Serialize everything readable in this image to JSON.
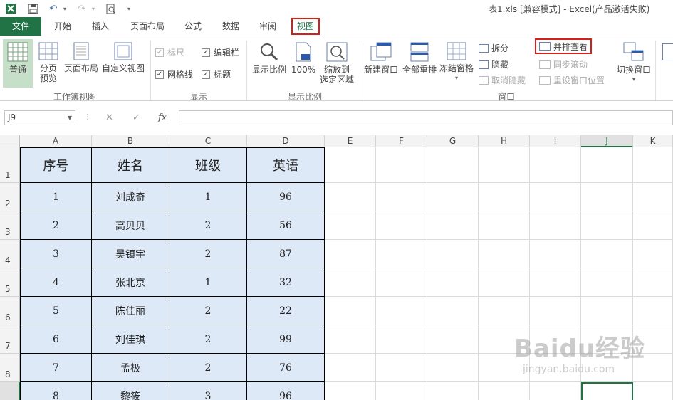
{
  "window": {
    "title": "表1.xls  [兼容模式] - Excel(产品激活失败)"
  },
  "quick_access": {
    "icons": [
      "excel-logo-icon",
      "save-icon",
      "undo-icon",
      "redo-icon",
      "print-preview-icon",
      "customize-icon"
    ]
  },
  "tabs": [
    {
      "label": "文件"
    },
    {
      "label": "开始"
    },
    {
      "label": "插入"
    },
    {
      "label": "页面布局"
    },
    {
      "label": "公式"
    },
    {
      "label": "数据"
    },
    {
      "label": "审阅"
    },
    {
      "label": "视图"
    }
  ],
  "ribbon": {
    "workbook_views": {
      "label": "工作簿视图",
      "normal": "普通",
      "page_break_preview": "分页\n预览",
      "page_layout": "页面布局",
      "custom_views": "自定义视图"
    },
    "show": {
      "label": "显示",
      "ruler": "标尺",
      "formula_bar": "编辑栏",
      "gridlines": "网格线",
      "headings": "标题"
    },
    "zoom": {
      "label": "显示比例",
      "zoom": "显示比例",
      "zoom_100": "100%",
      "zoom_to_selection": "缩放到\n选定区域"
    },
    "window": {
      "label": "窗口",
      "new_window": "新建窗口",
      "arrange_all": "全部重排",
      "freeze_panes": "冻结窗格",
      "split": "拆分",
      "hide": "隐藏",
      "unhide": "取消隐藏",
      "view_side_by_side": "并排查看",
      "sync_scroll": "同步滚动",
      "reset_position": "重设窗口位置",
      "switch_windows": "切换窗口"
    },
    "accent_color": "#217346",
    "highlight_color": "#d2201b"
  },
  "formula_bar": {
    "name_box": "J9",
    "cancel_icon": "✕",
    "enter_icon": "✓",
    "fx_label": "fx",
    "value": ""
  },
  "sheet": {
    "columns": [
      "A",
      "B",
      "C",
      "D",
      "E",
      "F",
      "G",
      "H",
      "I",
      "J",
      "K"
    ],
    "rows": [
      "1",
      "2",
      "3",
      "4",
      "5",
      "6",
      "7",
      "8"
    ],
    "selected_cell": "J9",
    "table": {
      "headers": [
        "序号",
        "姓名",
        "班级",
        "英语"
      ],
      "rows": [
        [
          "1",
          "刘成奇",
          "1",
          "96"
        ],
        [
          "2",
          "高贝贝",
          "2",
          "56"
        ],
        [
          "3",
          "吴镇宇",
          "2",
          "87"
        ],
        [
          "4",
          "张北京",
          "1",
          "32"
        ],
        [
          "5",
          "陈佳丽",
          "2",
          "22"
        ],
        [
          "6",
          "刘佳琪",
          "2",
          "99"
        ],
        [
          "7",
          "孟极",
          "2",
          "76"
        ],
        [
          "8",
          "黎筱",
          "3",
          "96"
        ]
      ],
      "fill_color": "#dde9f6"
    }
  },
  "watermark": {
    "brand": "Baidu经验",
    "url": "jingyan.baidu.com"
  }
}
